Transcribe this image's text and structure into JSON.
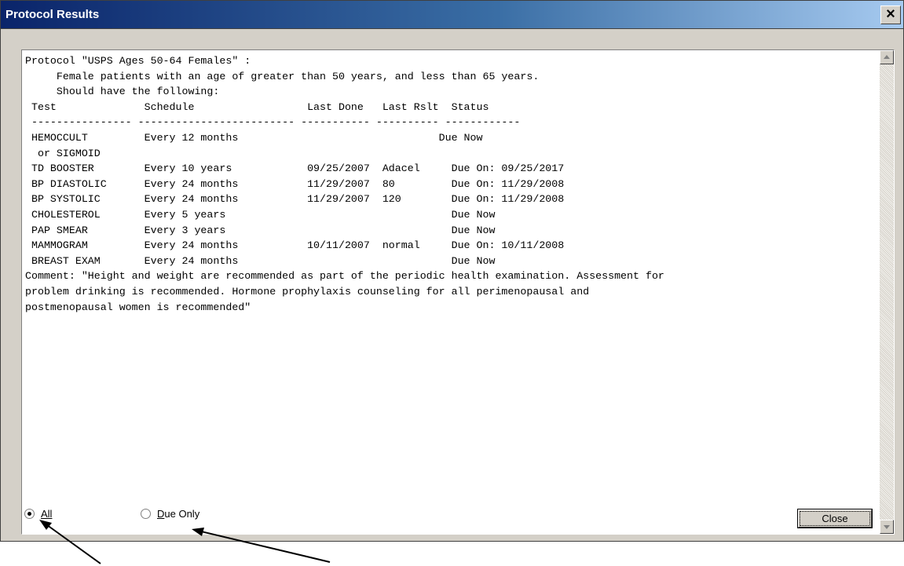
{
  "window": {
    "title": "Protocol Results",
    "close_glyph": "×"
  },
  "report": {
    "lines": [
      "Protocol \"USPS Ages 50-64 Females\" :",
      "     Female patients with an age of greater than 50 years, and less than 65 years.",
      "     Should have the following:",
      " Test              Schedule                  Last Done   Last Rslt  Status",
      " ---------------- ------------------------- ----------- ---------- ------------",
      " HEMOCCULT         Every 12 months                                Due Now",
      "  or SIGMOID",
      " TD BOOSTER        Every 10 years            09/25/2007  Adacel     Due On: 09/25/2017",
      " BP DIASTOLIC      Every 24 months           11/29/2007  80         Due On: 11/29/2008",
      " BP SYSTOLIC       Every 24 months           11/29/2007  120        Due On: 11/29/2008",
      " CHOLESTEROL       Every 5 years                                    Due Now",
      " PAP SMEAR         Every 3 years                                    Due Now",
      " MAMMOGRAM         Every 24 months           10/11/2007  normal     Due On: 10/11/2008",
      " BREAST EXAM       Every 24 months                                  Due Now",
      "Comment: \"Height and weight are recommended as part of the periodic health examination. Assessment for",
      "problem drinking is recommended. Hormone prophylaxis counseling for all perimenopausal and",
      "postmenopausal women is recommended\""
    ]
  },
  "filter": {
    "all_label": "All",
    "due_only_label": "Due Only",
    "selected": "All"
  },
  "buttons": {
    "close_label": "Close"
  },
  "icons": {
    "scroll_up": "scroll-up-arrow-icon",
    "scroll_down": "scroll-down-arrow-icon",
    "annotation_arrows": "pointer-arrow-icon"
  }
}
